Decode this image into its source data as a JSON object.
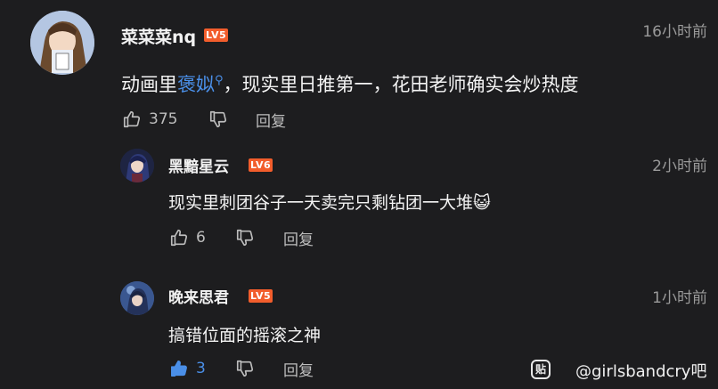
{
  "comment": {
    "username": "菜菜菜nq",
    "level": "LV5",
    "time": "16小时前",
    "text_before": "动画里",
    "text_link": "褒姒",
    "text_after": "，现实里日推第一，花田老师确实会炒热度",
    "likes": "375",
    "reply_label": "回复"
  },
  "replies": [
    {
      "username": "黑黯星云",
      "level": "LV6",
      "time": "2小时前",
      "text": "现实里刺团谷子一天卖完只剩钻团一大堆😺",
      "likes": "6",
      "reply_label": "回复",
      "liked": false
    },
    {
      "username": "晚来思君",
      "level": "LV5",
      "time": "1小时前",
      "text": "搞错位面的摇滚之神",
      "likes": "3",
      "reply_label": "回复",
      "liked": true
    }
  ],
  "watermark": {
    "icon_text": "贴",
    "text": "@girlsbandcry吧"
  },
  "colors": {
    "background": "#1d1d1f",
    "link": "#4a8fe8",
    "badge": "#f25d2c",
    "muted": "#9a9a9a"
  },
  "icons": [
    "thumb-up-icon",
    "thumb-down-icon",
    "search-icon",
    "tieba-icon"
  ]
}
